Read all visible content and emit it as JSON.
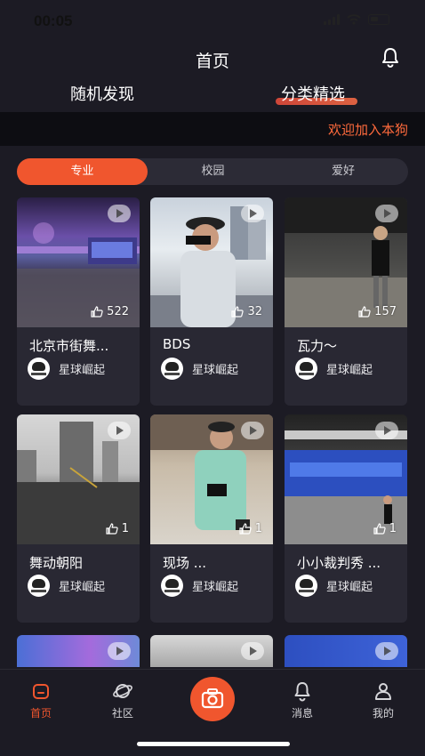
{
  "status": {
    "time": "00:05"
  },
  "header": {
    "title": "首页"
  },
  "top_tabs": [
    "随机发现",
    "分类精选"
  ],
  "marquee": "欢迎加入本狗",
  "segments": [
    "专业",
    "校园",
    "爱好"
  ],
  "cards": [
    {
      "title": "北京市街舞...",
      "likes": "522",
      "author": "星球崛起"
    },
    {
      "title": "BDS",
      "likes": "32",
      "author": "星球崛起"
    },
    {
      "title": "瓦力～",
      "likes": "157",
      "author": "星球崛起"
    },
    {
      "title": "舞动朝阳",
      "likes": "1",
      "author": "星球崛起"
    },
    {
      "title": "现场 ...",
      "likes": "1",
      "author": "星球崛起"
    },
    {
      "title": "小小裁判秀 ...",
      "likes": "1",
      "author": "星球崛起"
    }
  ],
  "tabbar": [
    "首页",
    "社区",
    "消息",
    "我的"
  ],
  "colors": {
    "accent": "#f0562e",
    "background": "#1c1b24",
    "card": "#292833"
  }
}
